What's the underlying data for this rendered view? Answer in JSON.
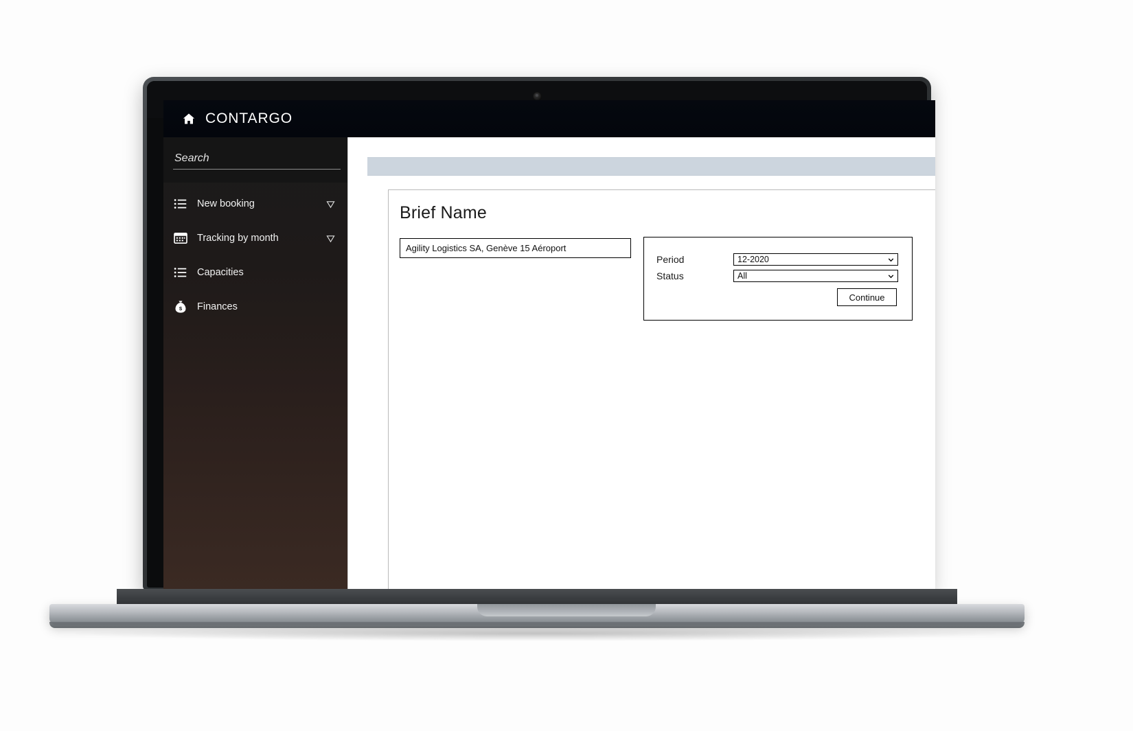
{
  "app": {
    "brand": "CONTARGO",
    "home_icon": "home-icon"
  },
  "sidebar": {
    "search": {
      "placeholder": "Search",
      "value": ""
    },
    "items": [
      {
        "label": "New booking",
        "icon": "list-icon",
        "caret": true
      },
      {
        "label": "Tracking by month",
        "icon": "calendar-icon",
        "caret": true
      },
      {
        "label": "Capacities",
        "icon": "list-icon",
        "caret": false
      },
      {
        "label": "Finances",
        "icon": "money-bag-icon",
        "caret": false
      }
    ]
  },
  "content": {
    "panel_title": "Brief Name",
    "brief_name": {
      "value": "Agility Logistics SA, Genève 15 Aéroport",
      "placeholder": ""
    },
    "filters": {
      "period": {
        "label": "Period",
        "value": "12-2020",
        "options": [
          "12-2020"
        ]
      },
      "status": {
        "label": "Status",
        "value": "All",
        "options": [
          "All"
        ]
      },
      "continue_label": "Continue"
    }
  },
  "colors": {
    "topbar": "#03060c",
    "sidebar_top": "#1b1b1b",
    "sidebar_bottom": "#3b2a23",
    "ribbon": "#ccd5de",
    "text_light": "#f2f2f2",
    "border": "#000000"
  }
}
